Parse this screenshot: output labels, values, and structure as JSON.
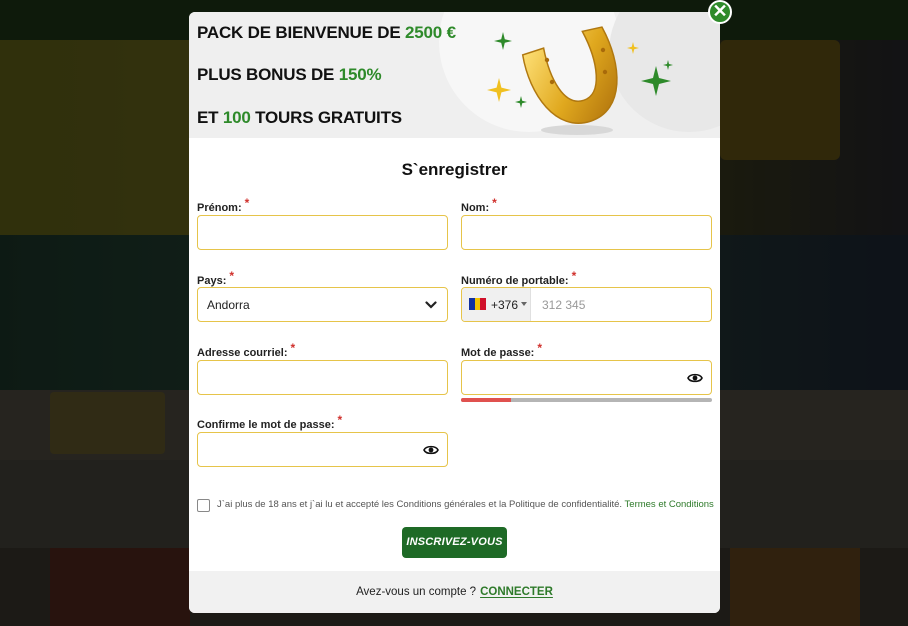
{
  "banner": {
    "line1_prefix": "PACK DE BIENVENUE DE ",
    "line1_highlight": "2500 €",
    "line2_prefix": "PLUS BONUS DE ",
    "line2_highlight": "150%",
    "line3_prefix": "ET ",
    "line3_highlight": "100",
    "line3_suffix": " TOURS GRATUITS"
  },
  "form": {
    "title": "S`enregistrer",
    "required_mark": "*",
    "first_name_label": "Prénom:",
    "last_name_label": "Nom:",
    "country_label": "Pays:",
    "country_value": "Andorra",
    "phone_label": "Numéro de portable:",
    "phone_dial_code": "+376",
    "phone_placeholder": "312 345",
    "email_label": "Adresse courriel:",
    "password_label": "Mot de passe:",
    "password_strength": 0.2,
    "confirm_password_label": "Confirme le mot de passe:",
    "terms_text": "J`ai plus de 18 ans et j`ai lu et accepté les Conditions générales et la Politique de confidentialité.",
    "terms_link": "Termes et Conditions",
    "submit_label": "INSCRIVEZ-VOUS"
  },
  "footer": {
    "question": "Avez-vous un compte ?",
    "connect_label": "CONNECTER"
  },
  "colors": {
    "accent_green": "#2e8a2a",
    "button_green": "#1e6a26",
    "field_border": "#e6c44a",
    "required_red": "#d0312d",
    "strength_red": "#e0514f"
  },
  "icons": {
    "close": "close-icon",
    "chevron": "chevron-down-icon",
    "eye": "eye-icon",
    "flag": "andorra-flag-icon",
    "horseshoe": "horseshoe-icon"
  }
}
